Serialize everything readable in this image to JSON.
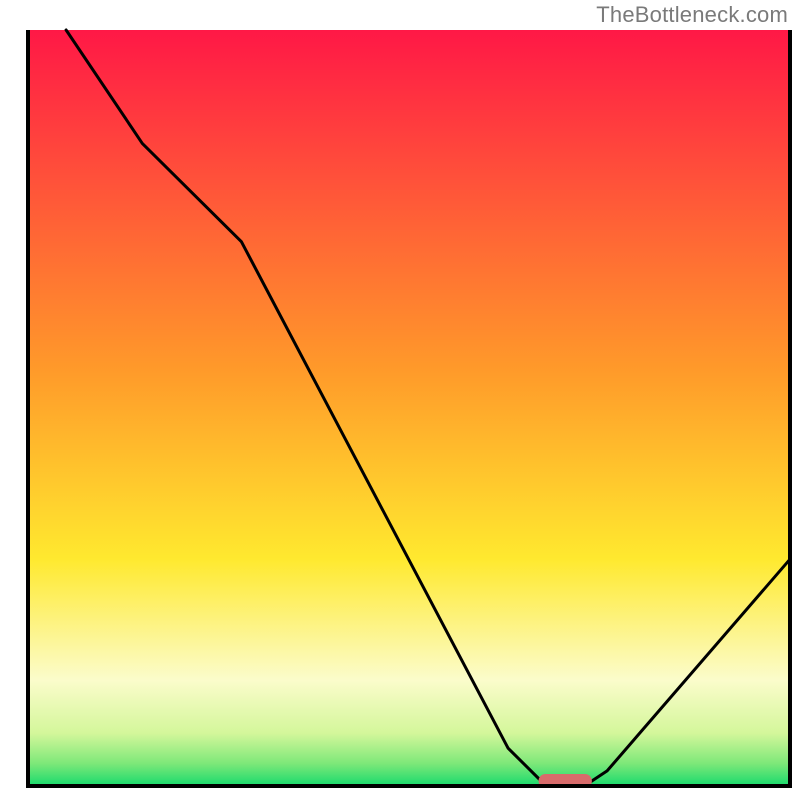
{
  "watermark": "TheBottleneck.com",
  "chart_data": {
    "type": "line",
    "title": "",
    "xlabel": "",
    "ylabel": "",
    "xlim": [
      0,
      100
    ],
    "ylim": [
      0,
      100
    ],
    "grid": false,
    "legend": false,
    "notes": "No axis ticks or numeric labels are visible. x and y are normalized 0–100 percent of plot area. y = bottleneck percentage (0 best, 100 worst). Curve shape read from pixel positions.",
    "series": [
      {
        "name": "bottleneck-curve",
        "x": [
          5,
          15,
          28,
          63,
          68,
          73,
          76,
          100
        ],
        "values": [
          100,
          85,
          72,
          5,
          0,
          0,
          2,
          30
        ]
      }
    ],
    "marker": {
      "name": "optimal-zone",
      "x_start": 67,
      "x_end": 74,
      "y": 0,
      "color": "#d86b6b"
    },
    "background_gradient": {
      "orientation": "vertical",
      "stops": [
        {
          "pos": 0.0,
          "color": "#ff1846"
        },
        {
          "pos": 0.45,
          "color": "#ff9a2a"
        },
        {
          "pos": 0.7,
          "color": "#ffe92f"
        },
        {
          "pos": 0.86,
          "color": "#fbfccb"
        },
        {
          "pos": 0.93,
          "color": "#d4f79b"
        },
        {
          "pos": 0.97,
          "color": "#7ee879"
        },
        {
          "pos": 1.0,
          "color": "#18da6d"
        }
      ]
    },
    "frame": {
      "left": true,
      "bottom": true,
      "right": true,
      "top": false,
      "color": "#000",
      "width": 4
    }
  }
}
